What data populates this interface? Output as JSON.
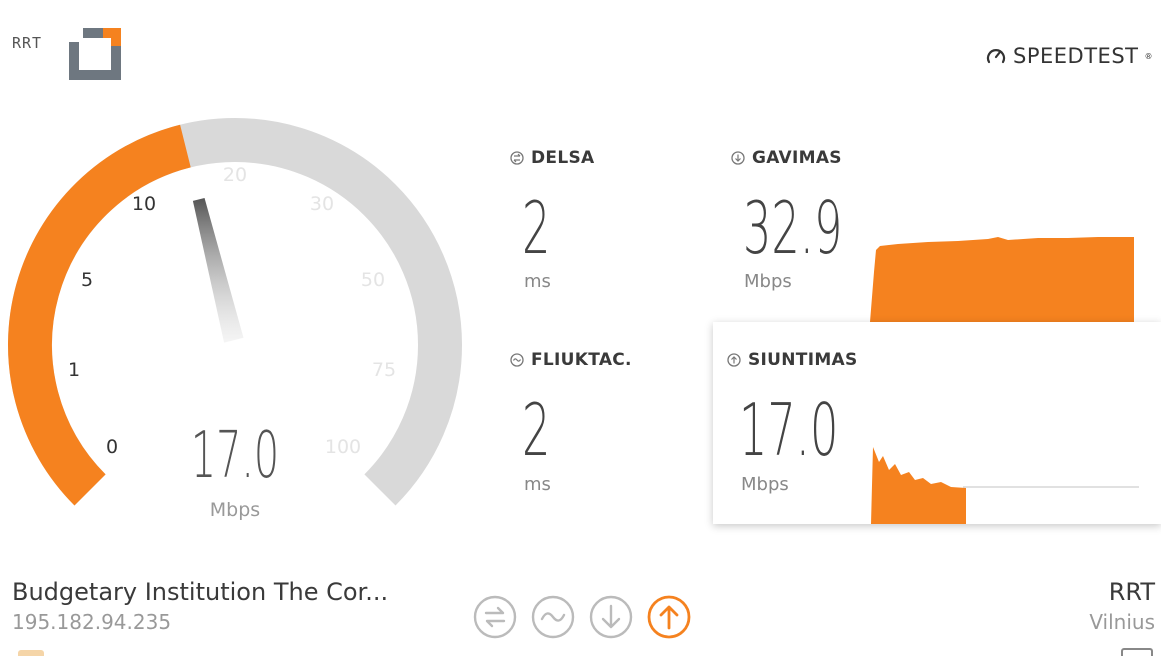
{
  "logo": {
    "text": "RRT"
  },
  "brand": {
    "name": "SPEEDTEST",
    "mark": "®"
  },
  "gauge": {
    "value": "17.0",
    "unit": "Mbps",
    "ticks": [
      "0",
      "1",
      "5",
      "10",
      "20",
      "30",
      "50",
      "75",
      "100"
    ],
    "active_color": "#f5821f",
    "track_color": "#d9d9d9"
  },
  "stats": {
    "ping": {
      "label": "DELSA",
      "value": "2",
      "unit": "ms",
      "icon": "ping-icon"
    },
    "jitter": {
      "label": "FLIUKTAC.",
      "value": "2",
      "unit": "ms",
      "icon": "jitter-icon"
    },
    "download": {
      "label": "GAVIMAS",
      "value": "32.9",
      "unit": "Mbps",
      "icon": "download-icon"
    },
    "upload": {
      "label": "SIUNTIMAS",
      "value": "17.0",
      "unit": "Mbps",
      "icon": "upload-icon"
    }
  },
  "server": {
    "name": "Budgetary Institution The Cor...",
    "ip": "195.182.94.235"
  },
  "isp": {
    "name": "RRT",
    "city": "Vilnius"
  },
  "steps": [
    {
      "name": "ping-step",
      "icon": "ping-icon",
      "state": "done"
    },
    {
      "name": "jitter-step",
      "icon": "jitter-icon",
      "state": "done"
    },
    {
      "name": "download-step",
      "icon": "download-icon",
      "state": "done"
    },
    {
      "name": "upload-step",
      "icon": "upload-icon",
      "state": "active"
    }
  ],
  "colors": {
    "accent": "#f5821f",
    "muted": "#bbbbbb",
    "text": "#3a3a3a"
  }
}
